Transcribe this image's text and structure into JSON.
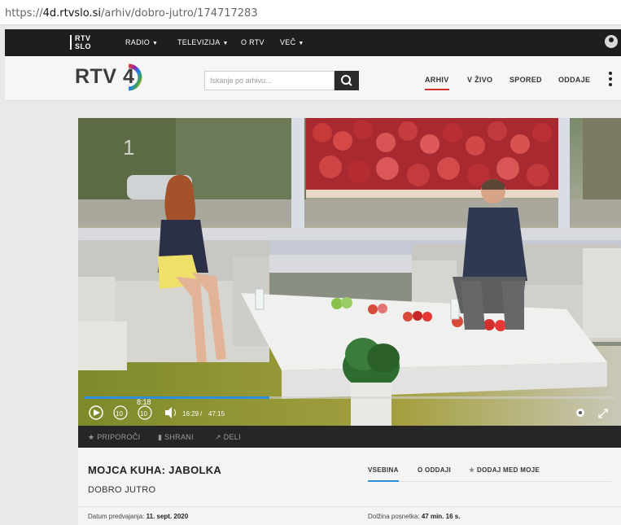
{
  "browser": {
    "url_prefix": "https://",
    "url_host": "4d.rtvslo.si",
    "url_path": "/arhiv/dobro-jutro/174717283"
  },
  "topnav": {
    "logo_line1": "RTV",
    "logo_line2": "SLO",
    "items": [
      {
        "label": "RADIO",
        "dropdown": "▼"
      },
      {
        "label": "TELEVIZIJA",
        "dropdown": "▼"
      },
      {
        "label": "O RTV",
        "dropdown": ""
      },
      {
        "label": "VEČ",
        "dropdown": "▼"
      }
    ]
  },
  "header": {
    "brand": "RTV",
    "brand_number": "4",
    "search_placeholder": "Iskanje po arhivu...",
    "nav": [
      "ARHIV",
      "V ŽIVO",
      "SPORED",
      "ODDAJE"
    ]
  },
  "player": {
    "channel_number": "1",
    "hover_time": "8:18",
    "skip_back": "10",
    "skip_forward": "10",
    "current_time": "16:29",
    "duration": "47:15",
    "progress_fraction": 0.349
  },
  "actions": [
    "PRIPOROČI",
    "SHRANI",
    "DELI"
  ],
  "episode": {
    "title": "MOJCA KUHA: JABOLKA",
    "show": "DOBRO JUTRO",
    "tabs": [
      "VSEBINA",
      "O ODDAJI",
      "DODAJ MED MOJE"
    ],
    "air_date_label": "Datum predvajanja:",
    "air_date": "11. sept. 2020",
    "length_label": "Dolžina posnetka:",
    "length": "47 min. 16 s."
  },
  "colors": {
    "accent_red": "#d32f2f",
    "tab_blue": "#2d8fd8",
    "dark_bar": "#1e1e1e"
  }
}
